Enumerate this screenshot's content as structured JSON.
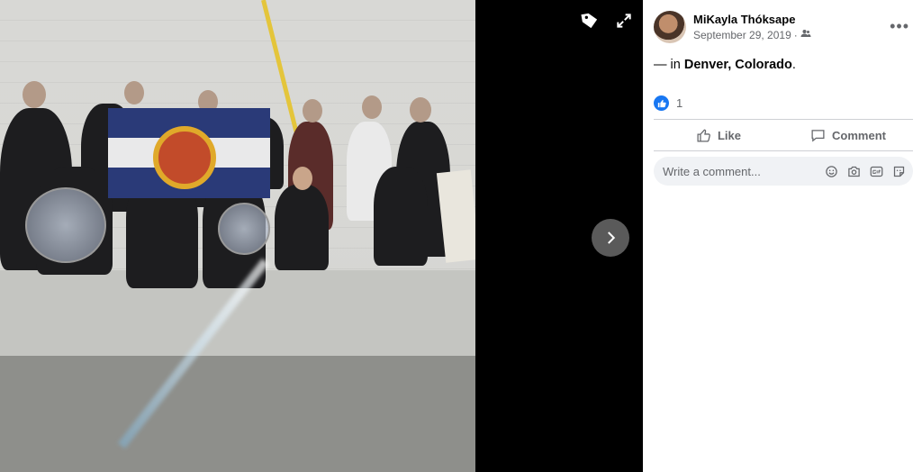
{
  "author": {
    "name": "MiKayla Thóksape",
    "date": "September 29, 2019",
    "separator": "·"
  },
  "post": {
    "prefix": "— in ",
    "location": "Denver, Colorado",
    "suffix": "."
  },
  "reactions": {
    "count": "1"
  },
  "actions": {
    "like_label": "Like",
    "comment_label": "Comment"
  },
  "comment": {
    "placeholder": "Write a comment..."
  },
  "colors": {
    "brand": "#1877f2",
    "muted_text": "#65676b"
  }
}
